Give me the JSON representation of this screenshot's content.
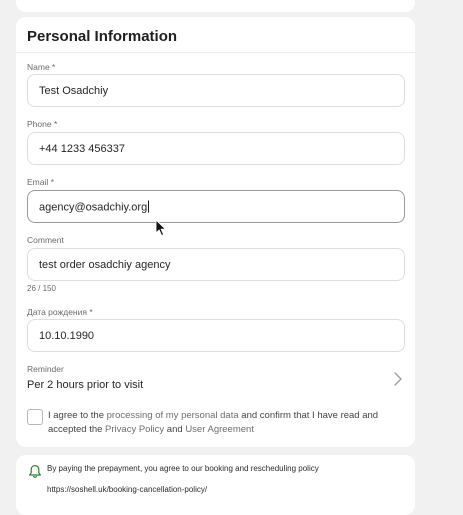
{
  "section_title": "Personal Information",
  "fields": {
    "name": {
      "label": "Name *",
      "value": "Test Osadchiy"
    },
    "phone": {
      "label": "Phone *",
      "value": "+44 1233 456337"
    },
    "email": {
      "label": "Email *",
      "value": "agency@osadchiy.org"
    },
    "comment": {
      "label": "Comment",
      "value": "test order osadchiy agency",
      "counter": "26 / 150"
    },
    "birthdate": {
      "label": "Дата рождения *",
      "value": "10.10.1990"
    }
  },
  "reminder": {
    "label": "Reminder",
    "value": "Per 2 hours prior to visit",
    "icon": "chevron-right-icon"
  },
  "consent": {
    "checked": false,
    "text_1": "I agree to the ",
    "link_processing": "processing of my personal data",
    "text_2": " and confirm that I have read and accepted the ",
    "link_privacy": "Privacy Policy",
    "text_3": " and ",
    "link_agreement": "User Agreement"
  },
  "notice": {
    "icon": "bell-icon",
    "text": "By paying the prepayment, you agree to our booking and rescheduling policy",
    "link": "https://soshell.uk/booking-cancellation-policy/"
  },
  "colors": {
    "page_background": "#f1f1f1",
    "card": "#ffffff",
    "input_border": "#dedede",
    "active_border": "#9a9a9a"
  }
}
